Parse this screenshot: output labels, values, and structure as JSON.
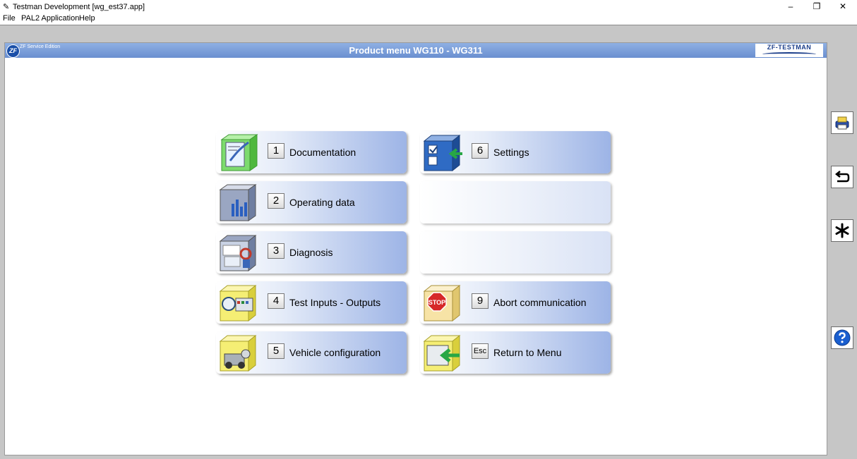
{
  "window": {
    "title": "Testman Development [wg_est37.app]",
    "minimize": "–",
    "restore": "❐",
    "close": "✕"
  },
  "menu": [
    "File",
    "PAL2 Application",
    "Help"
  ],
  "header": {
    "logo": "ZF",
    "edition": "ZF Service Edition",
    "title": "Product menu WG110 - WG311",
    "brand": "ZF-TESTMAN"
  },
  "tiles": [
    {
      "key": "1",
      "label": "Documentation",
      "icon": "documentation-icon"
    },
    {
      "key": "2",
      "label": "Operating data",
      "icon": "operating-data-icon"
    },
    {
      "key": "3",
      "label": "Diagnosis",
      "icon": "diagnosis-icon"
    },
    {
      "key": "4",
      "label": "Test Inputs - Outputs",
      "icon": "test-io-icon"
    },
    {
      "key": "5",
      "label": "Vehicle configuration",
      "icon": "vehicle-config-icon"
    },
    {
      "key": "6",
      "label": "Settings",
      "icon": "settings-icon"
    },
    {
      "key": "9",
      "label": "Abort communication",
      "icon": "stop-icon",
      "icon_text": "STOP"
    },
    {
      "key": "Esc",
      "label": "Return to Menu",
      "icon": "return-icon"
    }
  ],
  "sidebar": [
    "print-icon",
    "back-icon",
    "asterisk-icon",
    "help-icon"
  ],
  "colors": {
    "header": "#7a9ad8",
    "tile_end": "#9db4e6",
    "workspace": "#c6c6c6"
  }
}
